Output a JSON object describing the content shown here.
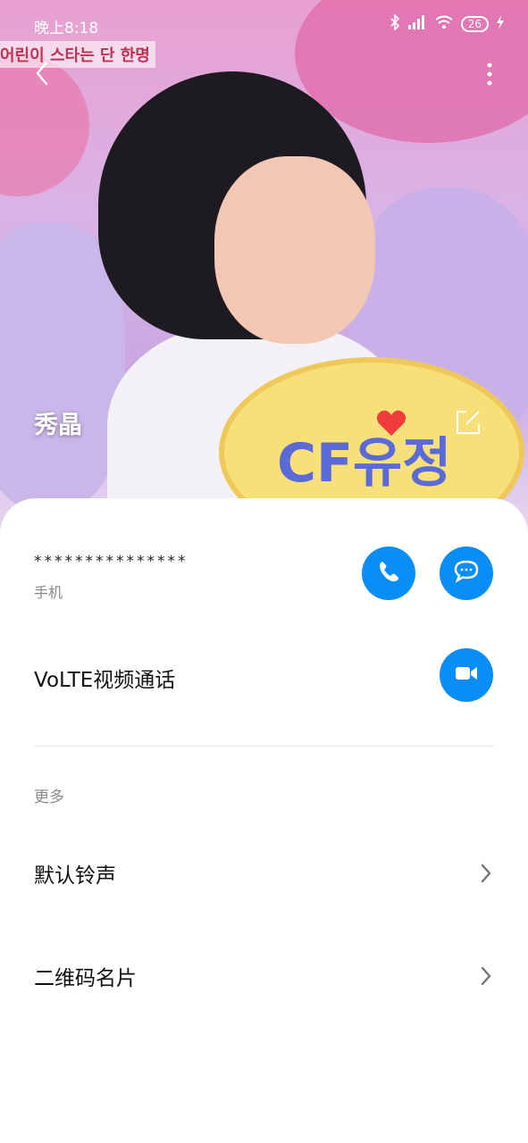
{
  "status_bar": {
    "time": "晚上8:18",
    "battery": "26"
  },
  "header": {
    "banner_text": "어린이 스타는 단 한명",
    "contact_name": "秀晶",
    "sign_text": "CF유정"
  },
  "phone": {
    "number": "***************",
    "type": "手机"
  },
  "volte": {
    "label": "VoLTE视频通话"
  },
  "more_section": {
    "title": "更多",
    "items": [
      {
        "label": "默认铃声"
      },
      {
        "label": "二维码名片"
      }
    ]
  },
  "colors": {
    "accent": "#0a8ef5",
    "favorite": "#ef3b3b"
  }
}
